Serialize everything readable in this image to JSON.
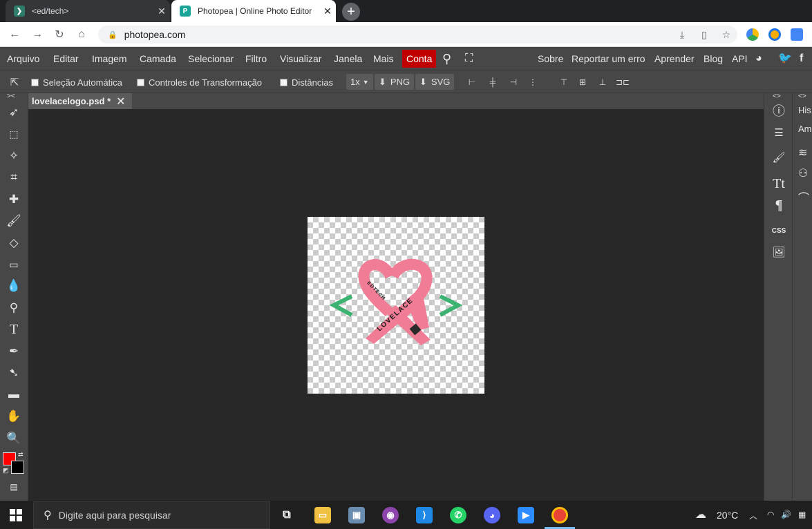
{
  "browser": {
    "tabs": [
      {
        "title": "<ed/tech>",
        "active": false
      },
      {
        "title": "Photopea | Online Photo Editor",
        "active": true
      }
    ],
    "url": "photopea.com"
  },
  "menu": {
    "items": [
      "Arquivo",
      "Editar",
      "Imagem",
      "Camada",
      "Selecionar",
      "Filtro",
      "Visualizar",
      "Janela",
      "Mais"
    ],
    "account": "Conta",
    "right_items": [
      "Sobre",
      "Reportar um erro",
      "Aprender",
      "Blog",
      "API"
    ]
  },
  "options": {
    "auto_select": "Seleção Automática",
    "transform_controls": "Controles de Transformação",
    "distances": "Distâncias",
    "scale": "1x",
    "png": "PNG",
    "svg": "SVG"
  },
  "document": {
    "tab_title": "lovelacelogo.psd *",
    "logo_text_left": "EDTECH",
    "logo_text_main": "LOVELACE",
    "logo_colors": {
      "ribbon": "#f07d95",
      "brackets": "#3cb371"
    }
  },
  "right_panel": {
    "labels": [
      "His",
      "Am"
    ],
    "css_label": "CSS"
  },
  "colors": {
    "foreground": "#ff0000",
    "background": "#000000"
  },
  "taskbar": {
    "search_placeholder": "Digite aqui para pesquisar",
    "temperature": "20°C"
  }
}
